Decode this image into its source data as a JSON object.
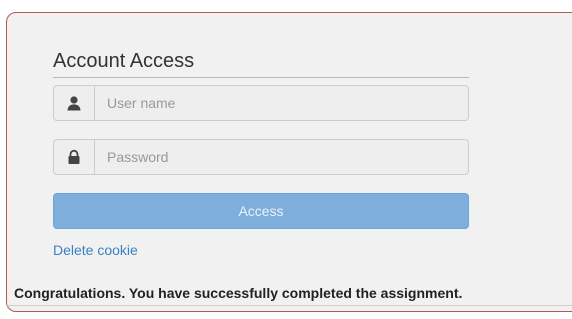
{
  "login_form": {
    "legend": "Account Access",
    "username": {
      "placeholder": "User name",
      "value": "",
      "icon": "user-icon"
    },
    "password": {
      "placeholder": "Password",
      "value": "",
      "icon": "lock-icon"
    },
    "access_button_label": "Access",
    "delete_cookie_label": "Delete cookie"
  },
  "feedback": {
    "message": "Congratulations. You have successfully completed the assignment."
  },
  "colors": {
    "panel_border": "#b05a5a",
    "panel_background": "#f1f1f1",
    "button_background": "#7eaedb",
    "link": "#3b82c4"
  }
}
